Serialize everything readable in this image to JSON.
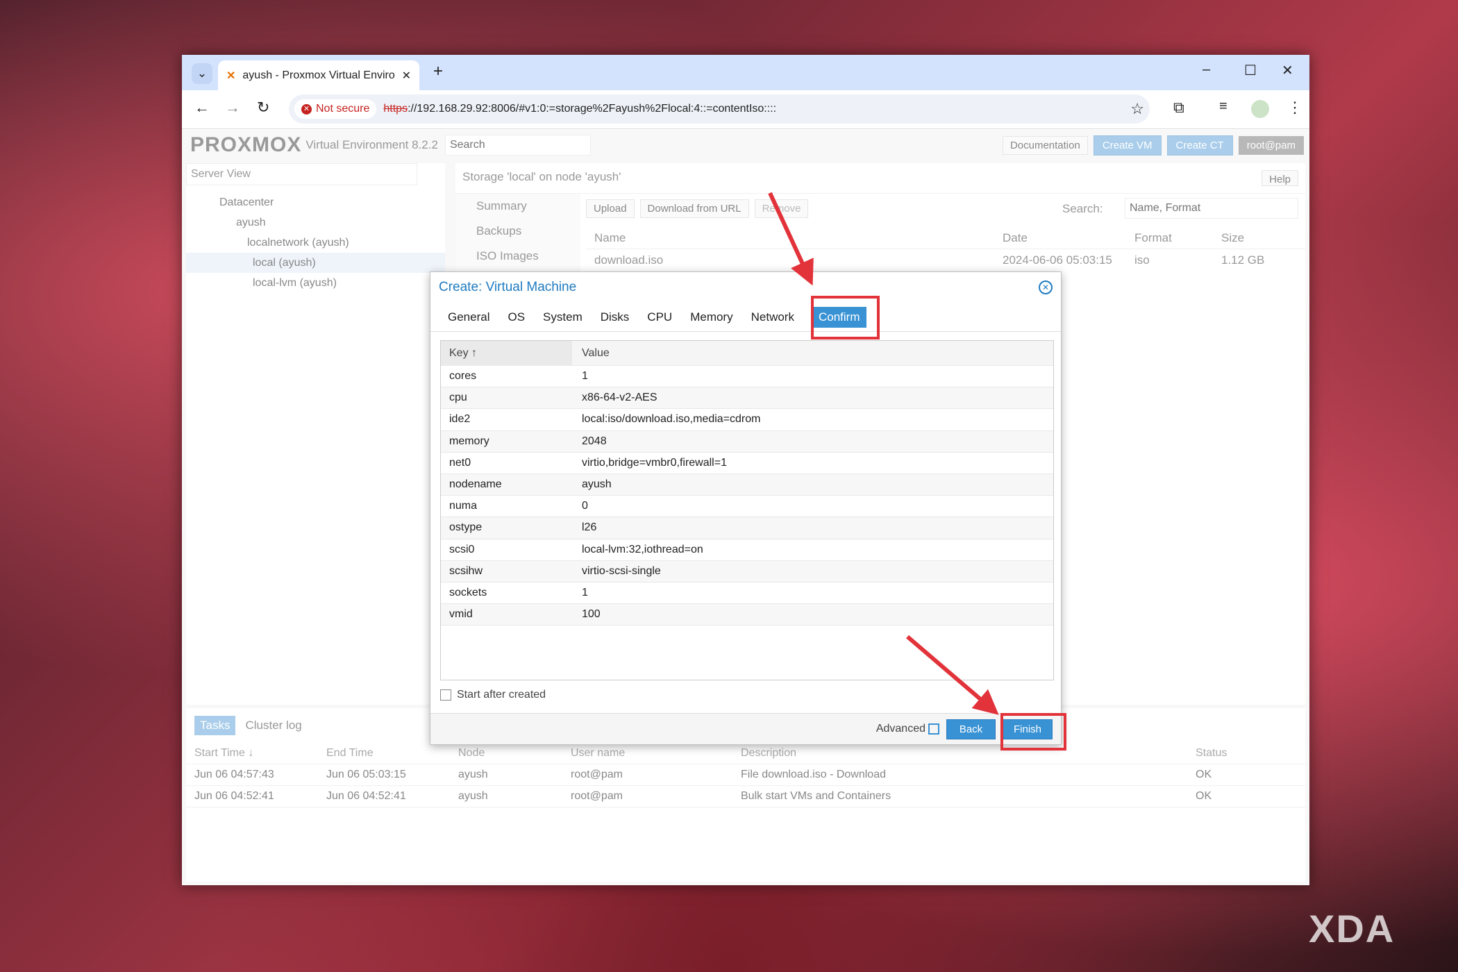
{
  "browser": {
    "tab_title": "ayush - Proxmox Virtual Enviro",
    "security": "Not secure",
    "url_scheme": "https",
    "url_rest": "://192.168.29.92:8006/#v1:0:=storage%2Fayush%2Flocal:4::=contentIso::::"
  },
  "header": {
    "logo": "PROXMOX",
    "version": "Virtual Environment 8.2.2",
    "search_placeholder": "Search",
    "documentation": "Documentation",
    "create_vm": "Create VM",
    "create_ct": "Create CT",
    "user": "root@pam"
  },
  "tree": {
    "view": "Server View",
    "items": [
      "Datacenter",
      "ayush",
      "localnetwork (ayush)",
      "local (ayush)",
      "local-lvm (ayush)"
    ]
  },
  "content": {
    "title": "Storage 'local' on node 'ayush'",
    "help": "Help",
    "nav": [
      "Summary",
      "Backups",
      "ISO Images"
    ],
    "toolbar": {
      "upload": "Upload",
      "download": "Download from URL",
      "remove": "Remove",
      "search_label": "Search:",
      "search_placeholder": "Name, Format"
    },
    "columns": [
      "Name",
      "Date",
      "Format",
      "Size"
    ],
    "rows": [
      [
        "download.iso",
        "2024-06-06 05:03:15",
        "iso",
        "1.12 GB"
      ]
    ]
  },
  "dialog": {
    "title": "Create: Virtual Machine",
    "tabs": [
      "General",
      "OS",
      "System",
      "Disks",
      "CPU",
      "Memory",
      "Network",
      "Confirm"
    ],
    "active_tab": "Confirm",
    "key_header": "Key ↑",
    "value_header": "Value",
    "rows": [
      [
        "cores",
        "1"
      ],
      [
        "cpu",
        "x86-64-v2-AES"
      ],
      [
        "ide2",
        "local:iso/download.iso,media=cdrom"
      ],
      [
        "memory",
        "2048"
      ],
      [
        "net0",
        "virtio,bridge=vmbr0,firewall=1"
      ],
      [
        "nodename",
        "ayush"
      ],
      [
        "numa",
        "0"
      ],
      [
        "ostype",
        "l26"
      ],
      [
        "scsi0",
        "local-lvm:32,iothread=on"
      ],
      [
        "scsihw",
        "virtio-scsi-single"
      ],
      [
        "sockets",
        "1"
      ],
      [
        "vmid",
        "100"
      ]
    ],
    "start_after_created": "Start after created",
    "advanced": "Advanced",
    "back": "Back",
    "finish": "Finish"
  },
  "tasks": {
    "tabs": [
      "Tasks",
      "Cluster log"
    ],
    "columns": [
      "Start Time ↓",
      "End Time",
      "Node",
      "User name",
      "Description",
      "Status"
    ],
    "rows": [
      [
        "Jun 06 04:57:43",
        "Jun 06 05:03:15",
        "ayush",
        "root@pam",
        "File download.iso - Download",
        "OK"
      ],
      [
        "Jun 06 04:52:41",
        "Jun 06 04:52:41",
        "ayush",
        "root@pam",
        "Bulk start VMs and Containers",
        "OK"
      ]
    ]
  },
  "watermark": "XDA",
  "colors": {
    "accent": "#3892d4",
    "highlight": "#e2323a",
    "title": "#1f7bc1"
  }
}
